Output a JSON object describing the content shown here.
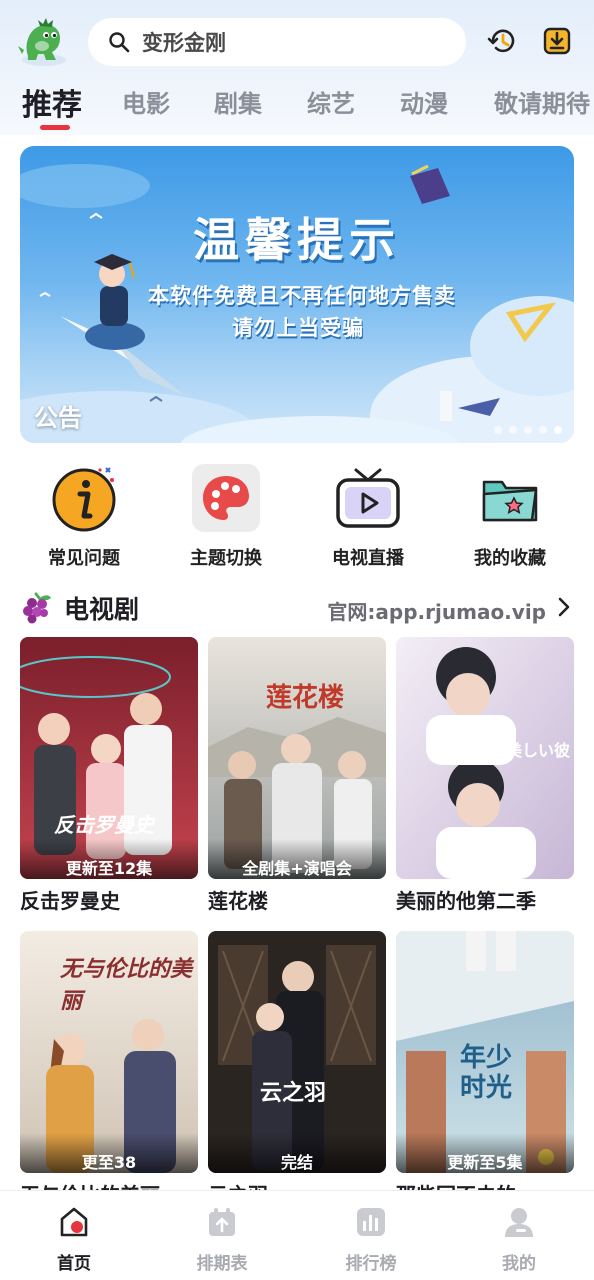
{
  "header": {
    "search_placeholder": "变形金刚",
    "icons": [
      "logo-dinosaur",
      "search-icon",
      "history-icon",
      "download-icon"
    ]
  },
  "tabs": [
    {
      "label": "推荐",
      "active": true
    },
    {
      "label": "电影"
    },
    {
      "label": "剧集"
    },
    {
      "label": "综艺"
    },
    {
      "label": "动漫"
    },
    {
      "label": "敬请期待"
    }
  ],
  "banner": {
    "title": "温馨提示",
    "line1": "本软件免费且不再任何地方售卖",
    "line2": "请勿上当受骗",
    "label": "公告",
    "slide_count": 5,
    "active_slide": 5
  },
  "shortcuts": [
    {
      "label": "常见问题",
      "icon": "info-icon"
    },
    {
      "label": "主题切换",
      "icon": "palette-icon"
    },
    {
      "label": "电视直播",
      "icon": "tv-icon"
    },
    {
      "label": "我的收藏",
      "icon": "folder-star-icon"
    }
  ],
  "section": {
    "title": "电视剧",
    "more": "官网:app.rjumao.vip",
    "icon": "grape-icon"
  },
  "shows": [
    {
      "title": "反击罗曼史",
      "badge": "更新至12集",
      "poster_text": "反击罗曼史"
    },
    {
      "title": "莲花楼",
      "badge": "全剧集+演唱会",
      "poster_text": "莲花楼"
    },
    {
      "title": "美丽的他第二季",
      "badge": "",
      "poster_text": "美しい彼"
    },
    {
      "title": "无与伦比的美丽",
      "badge": "更至38",
      "poster_text": "无与伦比的美丽"
    },
    {
      "title": "云之羽",
      "badge": "完结",
      "poster_text": "云之羽"
    },
    {
      "title": "那些回不去的…",
      "badge": "更新至5集",
      "poster_text": "年少时光"
    }
  ],
  "bottom_nav": [
    {
      "label": "首页",
      "active": true,
      "icon": "home-icon"
    },
    {
      "label": "排期表",
      "icon": "calendar-icon"
    },
    {
      "label": "排行榜",
      "icon": "ranking-icon"
    },
    {
      "label": "我的",
      "icon": "profile-icon"
    }
  ],
  "colors": {
    "accent": "#e8343f",
    "banner_blue": "#3e9ae6"
  }
}
